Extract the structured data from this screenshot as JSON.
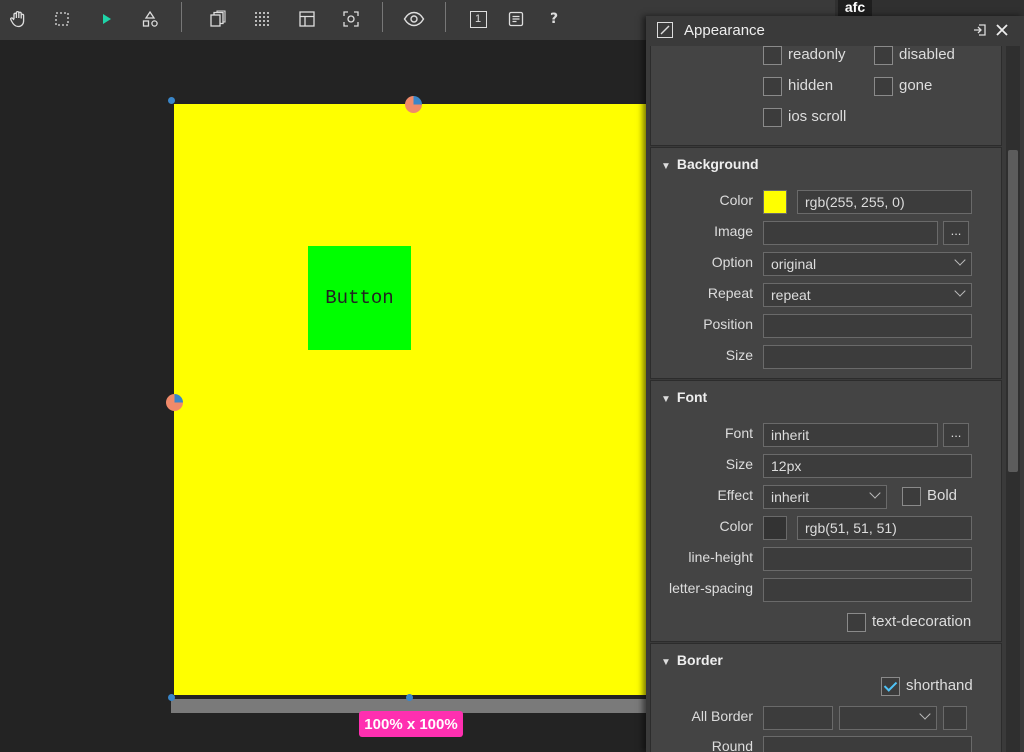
{
  "toolbar": {
    "icons": [
      "hand-icon",
      "select-rect-icon",
      "play-icon",
      "shapes-icon",
      "pages-icon",
      "grid-icon",
      "layout-icon",
      "focus-icon",
      "eye-icon",
      "page-number-icon",
      "notes-icon",
      "help-icon"
    ],
    "page_number": "1",
    "help": "?"
  },
  "canvas": {
    "button_label": "Button",
    "size_badge": "100% x 100%",
    "surface_color": "#ffff00",
    "button_color": "#00ff00"
  },
  "right_strip": {
    "tab_label": "afc"
  },
  "panel": {
    "title": "Appearance",
    "flags": [
      {
        "label": "readonly",
        "checked": false
      },
      {
        "label": "disabled",
        "checked": false
      },
      {
        "label": "hidden",
        "checked": false
      },
      {
        "label": "gone",
        "checked": false
      },
      {
        "label": "ios scroll",
        "checked": false
      }
    ],
    "background": {
      "title": "Background",
      "color_label": "Color",
      "color_value": "rgb(255, 255, 0)",
      "color_swatch": "#ffff00",
      "image_label": "Image",
      "image_value": "",
      "image_button": "...",
      "option_label": "Option",
      "option_value": "original",
      "repeat_label": "Repeat",
      "repeat_value": "repeat",
      "position_label": "Position",
      "position_value": "",
      "size_label": "Size",
      "size_value": ""
    },
    "font": {
      "title": "Font",
      "font_label": "Font",
      "font_value": "inherit",
      "font_button": "...",
      "size_label": "Size",
      "size_value": "12px",
      "effect_label": "Effect",
      "effect_value": "inherit",
      "bold_label": "Bold",
      "bold_checked": false,
      "color_label": "Color",
      "color_value": "rgb(51, 51, 51)",
      "color_swatch": "#333333",
      "line_height_label": "line-height",
      "line_height_value": "",
      "letter_spacing_label": "letter-spacing",
      "letter_spacing_value": "",
      "text_decoration_label": "text-decoration",
      "text_decoration_checked": false
    },
    "border": {
      "title": "Border",
      "shorthand_label": "shorthand",
      "shorthand_checked": true,
      "all_border_label": "All Border",
      "all_border_value": "",
      "all_border_style": "",
      "round_label": "Round",
      "round_value": ""
    }
  }
}
